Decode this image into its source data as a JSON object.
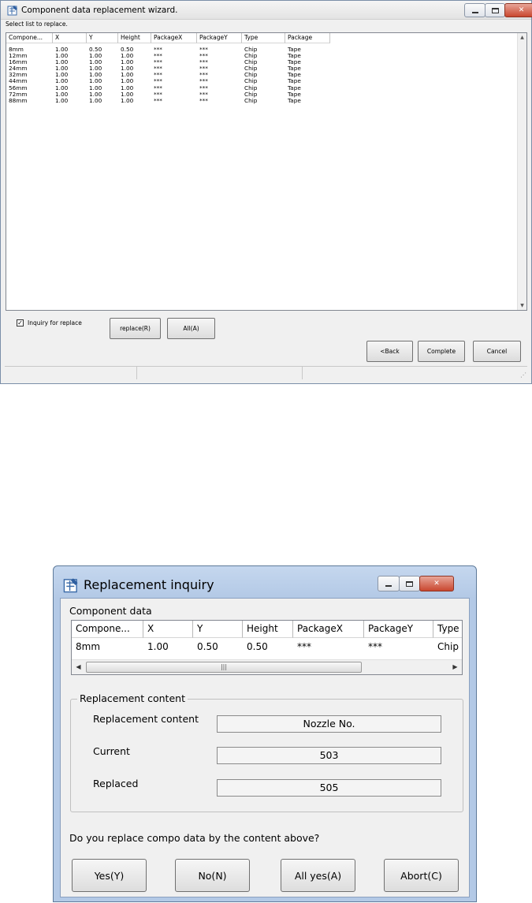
{
  "wizard": {
    "title": "Component data replacement wizard.",
    "hint": "Select list to replace.",
    "columns": [
      "Compone...",
      "X",
      "Y",
      "Height",
      "PackageX",
      "PackageY",
      "Type",
      "Package"
    ],
    "rows": [
      [
        "8mm",
        "1.00",
        "0.50",
        "0.50",
        "***",
        "***",
        "Chip",
        "Tape"
      ],
      [
        "12mm",
        "1.00",
        "1.00",
        "1.00",
        "***",
        "***",
        "Chip",
        "Tape"
      ],
      [
        "16mm",
        "1.00",
        "1.00",
        "1.00",
        "***",
        "***",
        "Chip",
        "Tape"
      ],
      [
        "24mm",
        "1.00",
        "1.00",
        "1.00",
        "***",
        "***",
        "Chip",
        "Tape"
      ],
      [
        "32mm",
        "1.00",
        "1.00",
        "1.00",
        "***",
        "***",
        "Chip",
        "Tape"
      ],
      [
        "44mm",
        "1.00",
        "1.00",
        "1.00",
        "***",
        "***",
        "Chip",
        "Tape"
      ],
      [
        "56mm",
        "1.00",
        "1.00",
        "1.00",
        "***",
        "***",
        "Chip",
        "Tape"
      ],
      [
        "72mm",
        "1.00",
        "1.00",
        "1.00",
        "***",
        "***",
        "Chip",
        "Tape"
      ],
      [
        "88mm",
        "1.00",
        "1.00",
        "1.00",
        "***",
        "***",
        "Chip",
        "Tape"
      ]
    ],
    "inquiry_checked": true,
    "inquiry_label": "Inquiry for replace",
    "replace_label": "replace(R)",
    "all_label": "All(A)",
    "back_label": "<Back",
    "complete_label": "Complete",
    "cancel_label": "Cancel"
  },
  "inquiry": {
    "title": "Replacement inquiry",
    "component_data_label": "Component data",
    "columns": [
      "Compone...",
      "X",
      "Y",
      "Height",
      "PackageX",
      "PackageY",
      "Type"
    ],
    "row": [
      "8mm",
      "1.00",
      "0.50",
      "0.50",
      "***",
      "***",
      "Chip"
    ],
    "group_title": "Replacement content",
    "content_label": "Replacement content",
    "content_value": "Nozzle No.",
    "current_label": "Current",
    "current_value": "503",
    "replaced_label": "Replaced",
    "replaced_value": "505",
    "question": "Do you replace compo data by the content above?",
    "yes_label": "Yes(Y)",
    "no_label": "No(N)",
    "allyes_label": "All yes(A)",
    "abort_label": "Abort(C)"
  }
}
